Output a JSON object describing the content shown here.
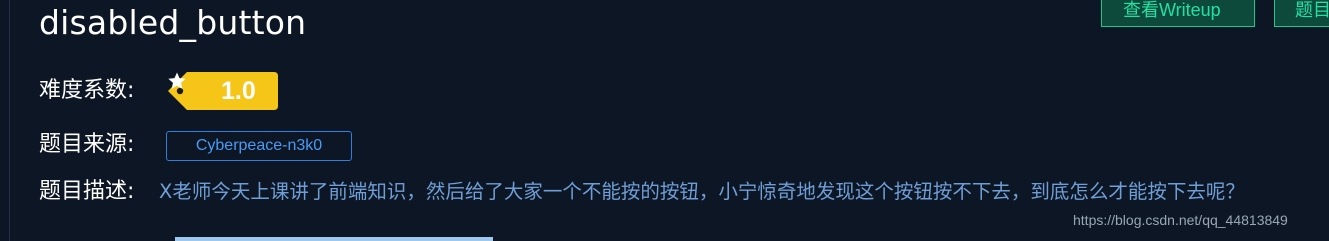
{
  "challenge": {
    "title": "disabled_button"
  },
  "header_buttons": {
    "writeup_label": "查看Writeup",
    "second_label": "题目"
  },
  "details": {
    "difficulty_label": "难度系数:",
    "difficulty_value": "1.0",
    "source_label": "题目来源:",
    "source_value": "Cyberpeace-n3k0",
    "description_label": "题目描述:",
    "description_text": "X老师今天上课讲了前端知识，然后给了大家一个不能按的按钮，小宁惊奇地发现这个按钮按不下去，到底怎么才能按下去呢？"
  },
  "watermark": {
    "text": "https://blog.csdn.net/qq_44813849"
  },
  "colors": {
    "background": "#0c1624",
    "button_accent": "#24e0a0",
    "difficulty_tag": "#f5c518",
    "source_badge": "#4a9af5",
    "description_text": "#6f9ed6"
  },
  "icons": {
    "difficulty_icon": "star-icon"
  }
}
